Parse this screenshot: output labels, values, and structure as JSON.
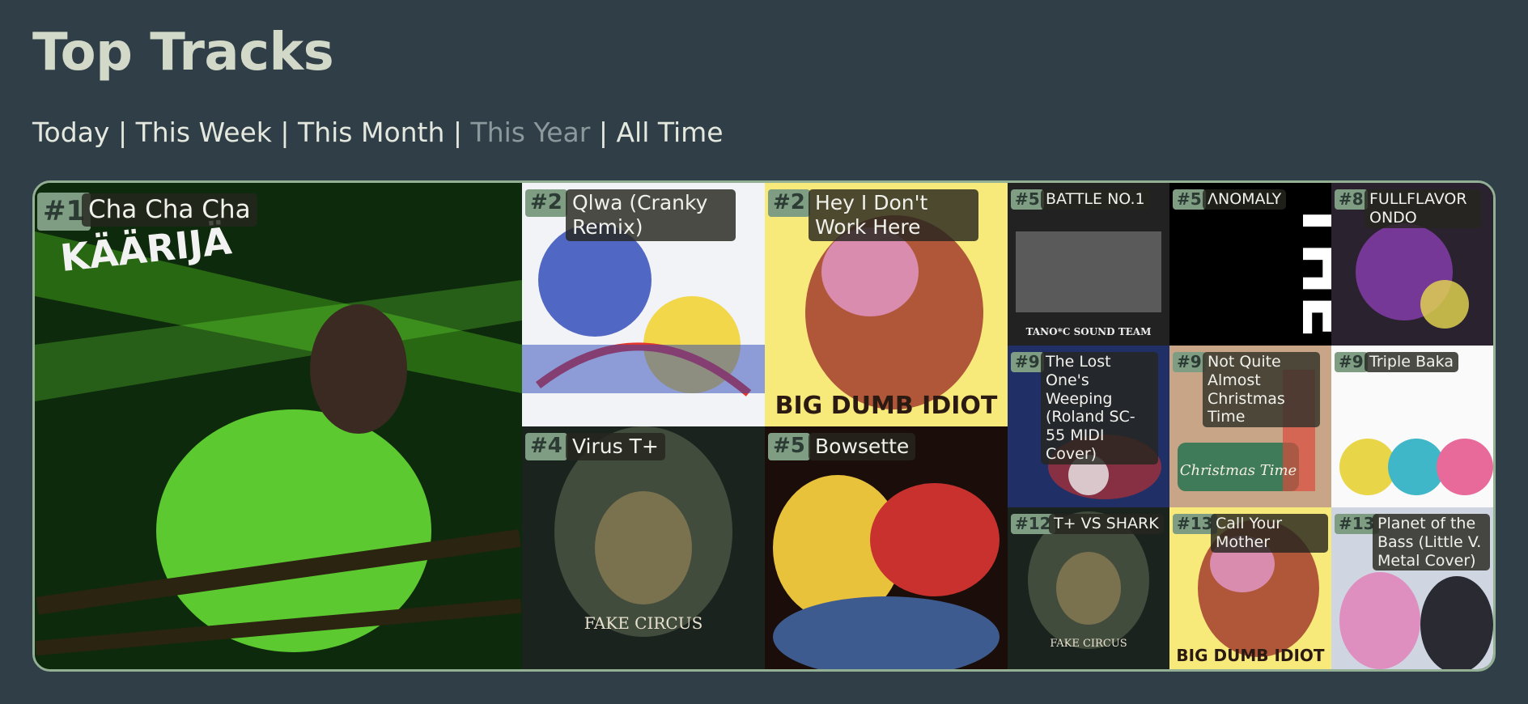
{
  "page": {
    "title": "Top Tracks"
  },
  "periods": [
    {
      "label": "Today",
      "active": false
    },
    {
      "label": "This Week",
      "active": false
    },
    {
      "label": "This Month",
      "active": false
    },
    {
      "label": "This Year",
      "active": true
    },
    {
      "label": "All Time",
      "active": false
    }
  ],
  "separator": "|",
  "tracks": [
    {
      "rank": "#1",
      "title": "Cha Cha Cha",
      "cover_text": "KÄÄRIJÄ",
      "palette": [
        "#0e2a0c",
        "#3f9b1a",
        "#78ff3c"
      ]
    },
    {
      "rank": "#2",
      "title": "Qlwa (Cranky Remix)",
      "palette": [
        "#f2f3f7",
        "#2745b5",
        "#f2d12c"
      ]
    },
    {
      "rank": "#2",
      "title": "Hey I Don't Work Here",
      "cover_text": "BIG DUMB IDIOT",
      "palette": [
        "#f7ea7b",
        "#b0573a",
        "#2b1a12"
      ]
    },
    {
      "rank": "#4",
      "title": "Virus T+",
      "cover_text": "FAKE CIRCUS",
      "palette": [
        "#1b231e",
        "#4c5644",
        "#a08a5a"
      ]
    },
    {
      "rank": "#5",
      "title": "Bowsette",
      "palette": [
        "#1a0d0a",
        "#e9c23c",
        "#c8312d"
      ]
    },
    {
      "rank": "#5",
      "title": "BATTLE NO.1",
      "cover_text": "TANO*C SOUND TEAM",
      "palette": [
        "#222222",
        "#5a5a5a",
        "#eeeeee"
      ]
    },
    {
      "rank": "#5",
      "title": "ΛNOMALY",
      "cover_text": "THE BOSS",
      "palette": [
        "#000000",
        "#ffffff",
        "#222222"
      ]
    },
    {
      "rank": "#8",
      "title": "FULLFLAVOR ONDO",
      "palette": [
        "#2b2230",
        "#8a3fb0",
        "#e7d94f"
      ]
    },
    {
      "rank": "#9",
      "title": "The Lost One's Weeping (Roland SC-55 MIDI Cover)",
      "palette": [
        "#101426",
        "#2b4293",
        "#b42f35"
      ]
    },
    {
      "rank": "#9",
      "title": "Not Quite Almost Christmas Time",
      "cover_text": "Christmas Time",
      "palette": [
        "#c9a587",
        "#3f7b58",
        "#d94b3d"
      ]
    },
    {
      "rank": "#9",
      "title": "Triple Baka",
      "palette": [
        "#fafafa",
        "#e8d648",
        "#3fb7c9"
      ]
    },
    {
      "rank": "#12",
      "title": "T+ VS SHARK",
      "cover_text": "FAKE CIRCUS",
      "palette": [
        "#1b231e",
        "#4c5644",
        "#a08a5a"
      ]
    },
    {
      "rank": "#13",
      "title": "Call Your Mother",
      "cover_text": "BIG DUMB IDIOT",
      "palette": [
        "#f7ea7b",
        "#b0573a",
        "#2b1a12"
      ]
    },
    {
      "rank": "#13",
      "title": "Planet of the Bass (Little V. Metal Cover)",
      "palette": [
        "#cfd6e2",
        "#e85fa8",
        "#2a2a32"
      ]
    }
  ]
}
